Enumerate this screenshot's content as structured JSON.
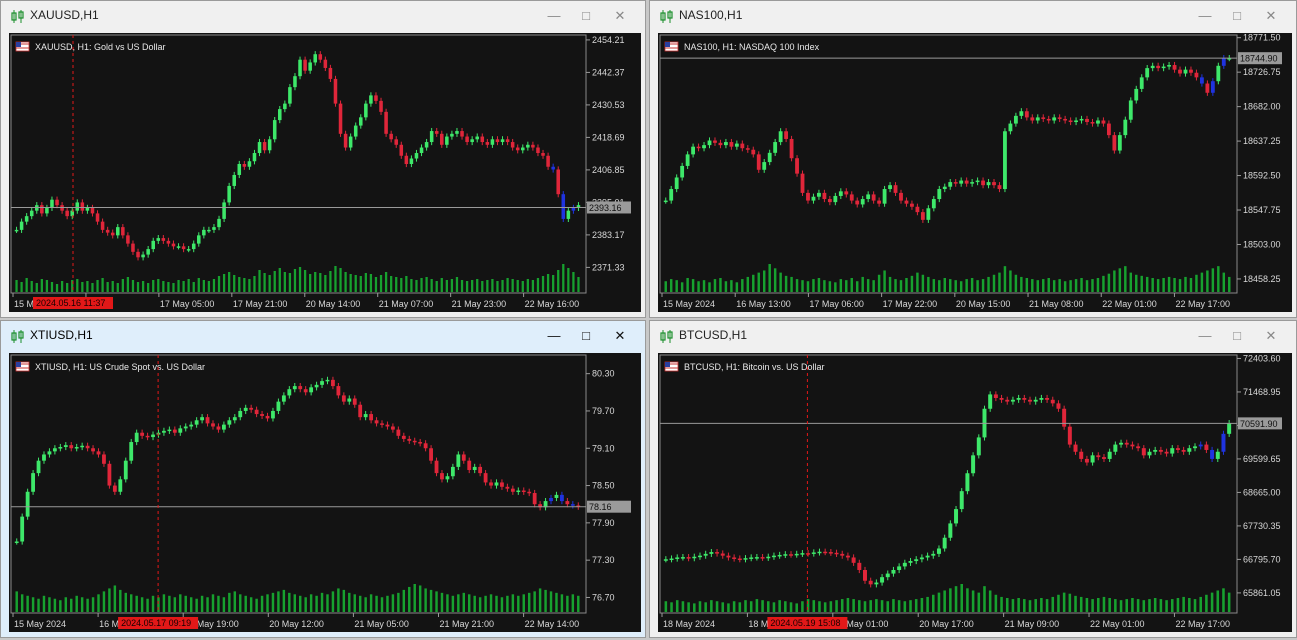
{
  "colors": {
    "bull": "#3ee86a",
    "bear": "#e0263a",
    "recent": "#1f33e0",
    "volume": "#17a12f",
    "grid": "#5a5a5a",
    "marker": "#e21818"
  },
  "windows": [
    {
      "title": "XAUUSD,H1",
      "label": "XAUUSD, H1:  Gold vs US Dollar",
      "active": false,
      "price_ticks": [
        "2454.21",
        "2442.37",
        "2430.53",
        "2418.69",
        "2406.85",
        "2395.01",
        "2383.17",
        "2371.33"
      ],
      "current_price": "2393.16",
      "time_ticks": [
        "15 M",
        "12:00",
        "17 May 05:00",
        "17 May 21:00",
        "20 May 14:00",
        "21 May 07:00",
        "21 May 23:00",
        "22 May 16:00"
      ],
      "marker": "2024.05.16 11:37",
      "marker_after_tick": 0,
      "chart_data": {
        "type": "candlestick",
        "ylim": [
          2362,
          2456
        ],
        "closes": [
          2385,
          2388,
          2390,
          2392,
          2394,
          2391,
          2393,
          2396,
          2394,
          2392,
          2390,
          2392,
          2395,
          2392,
          2393,
          2391,
          2388,
          2385,
          2384,
          2383,
          2386,
          2383,
          2380,
          2377,
          2375,
          2376,
          2378,
          2381,
          2382,
          2381,
          2380,
          2379,
          2379,
          2378,
          2378,
          2380,
          2383,
          2385,
          2385,
          2386,
          2389,
          2395,
          2401,
          2405,
          2409,
          2408,
          2410,
          2413,
          2417,
          2414,
          2418,
          2425,
          2429,
          2431,
          2437,
          2441,
          2447,
          2443,
          2446,
          2449,
          2447,
          2444,
          2440,
          2431,
          2420,
          2415,
          2419,
          2423,
          2426,
          2431,
          2434,
          2432,
          2428,
          2420,
          2418,
          2416,
          2412,
          2409,
          2411,
          2413,
          2415,
          2417,
          2421,
          2420,
          2416,
          2419,
          2420,
          2421,
          2419,
          2417,
          2418,
          2419,
          2417,
          2416,
          2418,
          2417,
          2418,
          2417,
          2415,
          2414,
          2415,
          2416,
          2415,
          2413,
          2412,
          2408,
          2407,
          2398,
          2389,
          2392,
          2393,
          2394
        ],
        "volumes": [
          12,
          10,
          14,
          11,
          9,
          13,
          12,
          10,
          8,
          11,
          9,
          12,
          13,
          10,
          11,
          9,
          12,
          14,
          10,
          11,
          9,
          13,
          15,
          12,
          10,
          11,
          9,
          12,
          13,
          11,
          10,
          9,
          12,
          11,
          13,
          10,
          14,
          12,
          11,
          13,
          16,
          18,
          20,
          17,
          15,
          14,
          13,
          16,
          22,
          19,
          17,
          21,
          24,
          20,
          19,
          23,
          25,
          22,
          18,
          20,
          19,
          17,
          21,
          26,
          24,
          20,
          18,
          17,
          16,
          19,
          18,
          15,
          17,
          20,
          16,
          15,
          14,
          16,
          13,
          12,
          14,
          15,
          13,
          11,
          14,
          12,
          13,
          15,
          12,
          11,
          12,
          13,
          11,
          12,
          13,
          11,
          12,
          14,
          13,
          12,
          11,
          13,
          12,
          14,
          16,
          18,
          17,
          22,
          28,
          24,
          20,
          15
        ]
      }
    },
    {
      "title": "NAS100,H1",
      "label": "NAS100, H1:  NASDAQ 100 Index",
      "active": false,
      "price_ticks": [
        "18771.50",
        "18726.75",
        "18682.00",
        "18637.25",
        "18592.50",
        "18547.75",
        "18503.00",
        "18458.25"
      ],
      "current_price": "18744.90",
      "time_ticks": [
        "15 May 2024",
        "16 May 13:00",
        "17 May 06:00",
        "17 May 22:00",
        "20 May 15:00",
        "21 May 08:00",
        "22 May 01:00",
        "22 May 17:00"
      ],
      "marker": "",
      "marker_after_tick": -1,
      "chart_data": {
        "type": "candlestick",
        "ylim": [
          18440,
          18775
        ],
        "closes": [
          18560,
          18575,
          18590,
          18605,
          18620,
          18630,
          18628,
          18632,
          18638,
          18635,
          18632,
          18636,
          18630,
          18634,
          18628,
          18626,
          18620,
          18600,
          18610,
          18622,
          18636,
          18650,
          18640,
          18615,
          18595,
          18570,
          18560,
          18565,
          18570,
          18562,
          18558,
          18566,
          18572,
          18568,
          18560,
          18555,
          18562,
          18568,
          18560,
          18556,
          18575,
          18580,
          18570,
          18560,
          18556,
          18552,
          18545,
          18535,
          18550,
          18562,
          18575,
          18578,
          18584,
          18582,
          18586,
          18582,
          18584,
          18586,
          18580,
          18584,
          18580,
          18575,
          18650,
          18660,
          18670,
          18676,
          18668,
          18664,
          18668,
          18666,
          18664,
          18668,
          18666,
          18664,
          18662,
          18664,
          18666,
          18662,
          18660,
          18664,
          18660,
          18645,
          18625,
          18645,
          18665,
          18690,
          18705,
          18720,
          18732,
          18735,
          18732,
          18734,
          18736,
          18730,
          18725,
          18730,
          18726,
          18720,
          18712,
          18700,
          18715,
          18735,
          18745,
          18745
        ],
        "volumes": [
          10,
          12,
          11,
          9,
          13,
          12,
          10,
          11,
          9,
          12,
          13,
          10,
          11,
          9,
          12,
          14,
          16,
          18,
          20,
          26,
          22,
          18,
          15,
          14,
          12,
          11,
          10,
          12,
          13,
          11,
          10,
          9,
          12,
          11,
          13,
          10,
          14,
          12,
          11,
          16,
          20,
          14,
          12,
          11,
          13,
          15,
          18,
          16,
          14,
          12,
          11,
          13,
          12,
          11,
          10,
          12,
          13,
          11,
          12,
          14,
          16,
          18,
          24,
          20,
          16,
          14,
          13,
          12,
          11,
          12,
          13,
          11,
          12,
          10,
          11,
          12,
          13,
          11,
          12,
          13,
          15,
          17,
          20,
          22,
          24,
          18,
          16,
          15,
          14,
          13,
          12,
          13,
          14,
          13,
          12,
          14,
          13,
          16,
          18,
          20,
          22,
          24,
          18,
          14
        ]
      }
    },
    {
      "title": "XTIUSD,H1",
      "label": "XTIUSD, H1:  US Crude Spot vs. US Dollar",
      "active": true,
      "price_ticks": [
        "80.30",
        "79.70",
        "79.10",
        "78.50",
        "77.90",
        "77.30",
        "76.70"
      ],
      "current_price": "78.16",
      "time_ticks": [
        "15 May 2024",
        "16 May 10:",
        "17 May 19:00",
        "20 May 12:00",
        "21 May 05:00",
        "21 May 21:00",
        "22 May 14:00"
      ],
      "marker": "2024.05.17 09:19",
      "marker_after_tick": 1,
      "chart_data": {
        "type": "candlestick",
        "ylim": [
          76.45,
          80.6
        ],
        "closes": [
          77.6,
          78.0,
          78.4,
          78.7,
          78.9,
          79.0,
          79.05,
          79.1,
          79.12,
          79.15,
          79.1,
          79.12,
          79.14,
          79.1,
          79.05,
          79.0,
          78.85,
          78.5,
          78.4,
          78.6,
          78.9,
          79.2,
          79.35,
          79.3,
          79.28,
          79.32,
          79.35,
          79.38,
          79.4,
          79.35,
          79.42,
          79.45,
          79.48,
          79.55,
          79.6,
          79.5,
          79.45,
          79.4,
          79.48,
          79.55,
          79.6,
          79.7,
          79.75,
          79.72,
          79.65,
          79.62,
          79.58,
          79.7,
          79.85,
          79.95,
          80.05,
          80.1,
          80.05,
          80.0,
          80.08,
          80.12,
          80.18,
          80.2,
          80.1,
          79.95,
          79.85,
          79.9,
          79.8,
          79.6,
          79.65,
          79.55,
          79.5,
          79.48,
          79.45,
          79.4,
          79.3,
          79.25,
          79.22,
          79.2,
          79.18,
          79.1,
          78.9,
          78.7,
          78.6,
          78.65,
          78.8,
          79.0,
          78.9,
          78.75,
          78.8,
          78.7,
          78.55,
          78.5,
          78.55,
          78.48,
          78.45,
          78.4,
          78.42,
          78.4,
          78.38,
          78.2,
          78.15,
          78.25,
          78.3,
          78.35,
          78.25,
          78.2,
          78.18,
          78.16
        ],
        "volumes": [
          14,
          12,
          11,
          10,
          9,
          11,
          10,
          9,
          8,
          10,
          9,
          11,
          10,
          9,
          10,
          12,
          14,
          16,
          18,
          15,
          13,
          12,
          11,
          10,
          9,
          11,
          10,
          12,
          11,
          10,
          12,
          11,
          10,
          9,
          11,
          10,
          12,
          11,
          10,
          13,
          14,
          12,
          11,
          10,
          9,
          11,
          12,
          13,
          14,
          15,
          13,
          12,
          11,
          10,
          12,
          11,
          13,
          12,
          14,
          16,
          15,
          13,
          12,
          11,
          10,
          12,
          11,
          10,
          11,
          12,
          13,
          15,
          17,
          19,
          18,
          16,
          15,
          14,
          13,
          12,
          11,
          12,
          13,
          12,
          11,
          10,
          11,
          12,
          11,
          10,
          11,
          12,
          11,
          12,
          13,
          14,
          16,
          15,
          14,
          13,
          12,
          11,
          12,
          11
        ]
      }
    },
    {
      "title": "BTCUSD,H1",
      "label": "BTCUSD, H1:  Bitcoin vs. US Dollar",
      "active": false,
      "price_ticks": [
        "72403.60",
        "71468.95",
        "70534.30",
        "69599.65",
        "68665.00",
        "67730.35",
        "66795.70",
        "65861.05"
      ],
      "current_price": "70591.90",
      "time_ticks": [
        "18 May 2024",
        "18 May 17:",
        "20 May 01:00",
        "20 May 17:00",
        "21 May 09:00",
        "22 May 01:00",
        "22 May 17:00"
      ],
      "marker": "2024.05.19 15:08",
      "marker_after_tick": 1,
      "chart_data": {
        "type": "candlestick",
        "ylim": [
          65300,
          72500
        ],
        "closes": [
          66800,
          66820,
          66850,
          66860,
          66830,
          66870,
          66900,
          66950,
          67000,
          66960,
          66900,
          66850,
          66820,
          66800,
          66830,
          66850,
          66860,
          66840,
          66870,
          66900,
          66920,
          66940,
          66930,
          66950,
          66970,
          66960,
          66990,
          67010,
          67000,
          66980,
          66950,
          66900,
          66850,
          66700,
          66500,
          66200,
          66100,
          66150,
          66300,
          66400,
          66500,
          66600,
          66700,
          66750,
          66800,
          66850,
          66900,
          66950,
          67100,
          67400,
          67800,
          68200,
          68700,
          69200,
          69700,
          70200,
          71000,
          71400,
          71300,
          71250,
          71200,
          71250,
          71300,
          71250,
          71200,
          71250,
          71300,
          71250,
          71150,
          71000,
          70500,
          70000,
          69800,
          69600,
          69500,
          69700,
          69650,
          69600,
          69800,
          70000,
          70050,
          70000,
          69950,
          69900,
          69700,
          69800,
          69850,
          69800,
          69750,
          69900,
          69850,
          69800,
          69900,
          69950,
          70000,
          69850,
          69600,
          69800,
          70300,
          70600
        ],
        "volumes": [
          10,
          9,
          11,
          10,
          9,
          8,
          10,
          9,
          11,
          10,
          9,
          8,
          10,
          9,
          11,
          10,
          12,
          11,
          10,
          9,
          11,
          10,
          9,
          8,
          10,
          12,
          11,
          10,
          9,
          10,
          11,
          12,
          13,
          12,
          11,
          10,
          11,
          12,
          11,
          10,
          12,
          11,
          10,
          11,
          12,
          13,
          14,
          16,
          18,
          20,
          22,
          24,
          26,
          22,
          20,
          18,
          24,
          20,
          16,
          14,
          13,
          12,
          13,
          12,
          11,
          12,
          13,
          12,
          14,
          16,
          18,
          17,
          15,
          14,
          13,
          12,
          13,
          14,
          13,
          12,
          11,
          12,
          13,
          12,
          11,
          12,
          13,
          12,
          11,
          12,
          13,
          14,
          13,
          12,
          14,
          16,
          18,
          20,
          22,
          18
        ]
      }
    }
  ]
}
